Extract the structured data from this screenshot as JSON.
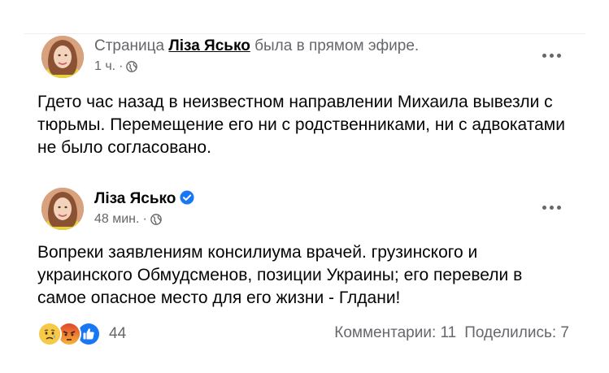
{
  "post1": {
    "header_prefix": "Страница ",
    "author_name": "Ліза Ясько",
    "header_suffix": " была в прямом эфире.",
    "time": "1 ч.",
    "dot": "·",
    "body_lines": [
      "Гдето час назад в неизвестном направлении Михаила вывезли с",
      "тюрьмы. Перемещение его ни с родственниками, ни с адвокатами",
      "не было согласовано."
    ]
  },
  "post2": {
    "author_name": "Ліза Ясько",
    "time": "48 мин.",
    "dot": "·",
    "body_lines": [
      "Вопреки заявлениям консилиума врачей. грузинского и",
      "украинского Обмудсменов, позиции Украины; его перевели в",
      "самое опасное место для его жизни - Глдани!"
    ]
  },
  "footer": {
    "reaction_icons": [
      "sad-icon",
      "angry-icon",
      "like-icon"
    ],
    "reaction_count": "44",
    "comments": "Комментарии: 11",
    "shares": "Поделились: 7"
  },
  "colors": {
    "secondary_text": "#65676b",
    "primary_text": "#050505",
    "verified": "#1877f2"
  }
}
